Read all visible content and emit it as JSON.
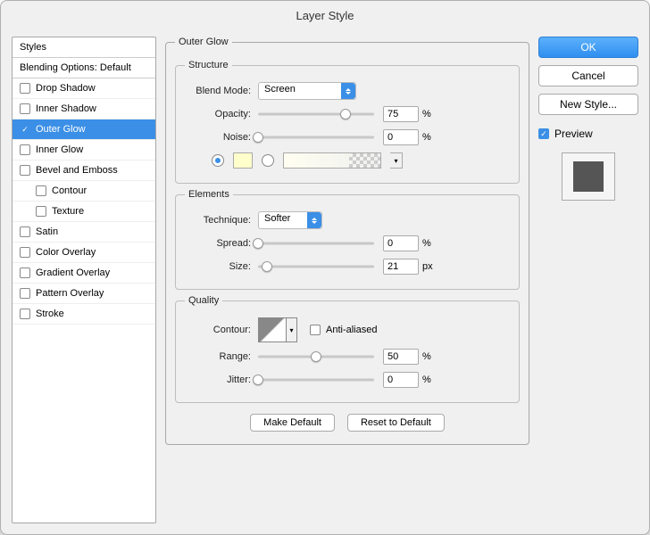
{
  "title": "Layer Style",
  "styles_header": "Styles",
  "blending_header": "Blending Options: Default",
  "styles": [
    {
      "label": "Drop Shadow",
      "checked": false
    },
    {
      "label": "Inner Shadow",
      "checked": false
    },
    {
      "label": "Outer Glow",
      "checked": true,
      "selected": true
    },
    {
      "label": "Inner Glow",
      "checked": false
    },
    {
      "label": "Bevel and Emboss",
      "checked": false
    },
    {
      "label": "Contour",
      "checked": false,
      "sub": true
    },
    {
      "label": "Texture",
      "checked": false,
      "sub": true
    },
    {
      "label": "Satin",
      "checked": false
    },
    {
      "label": "Color Overlay",
      "checked": false
    },
    {
      "label": "Gradient Overlay",
      "checked": false
    },
    {
      "label": "Pattern Overlay",
      "checked": false
    },
    {
      "label": "Stroke",
      "checked": false
    }
  ],
  "panel_title": "Outer Glow",
  "structure": {
    "legend": "Structure",
    "blend_mode_label": "Blend Mode:",
    "blend_mode_value": "Screen",
    "opacity_label": "Opacity:",
    "opacity_value": "75",
    "opacity_unit": "%",
    "noise_label": "Noise:",
    "noise_value": "0",
    "noise_unit": "%"
  },
  "elements": {
    "legend": "Elements",
    "technique_label": "Technique:",
    "technique_value": "Softer",
    "spread_label": "Spread:",
    "spread_value": "0",
    "spread_unit": "%",
    "size_label": "Size:",
    "size_value": "21",
    "size_unit": "px"
  },
  "quality": {
    "legend": "Quality",
    "contour_label": "Contour:",
    "antialiased_label": "Anti-aliased",
    "range_label": "Range:",
    "range_value": "50",
    "range_unit": "%",
    "jitter_label": "Jitter:",
    "jitter_value": "0",
    "jitter_unit": "%"
  },
  "buttons": {
    "make_default": "Make Default",
    "reset_default": "Reset to Default",
    "ok": "OK",
    "cancel": "Cancel",
    "new_style": "New Style...",
    "preview": "Preview"
  }
}
